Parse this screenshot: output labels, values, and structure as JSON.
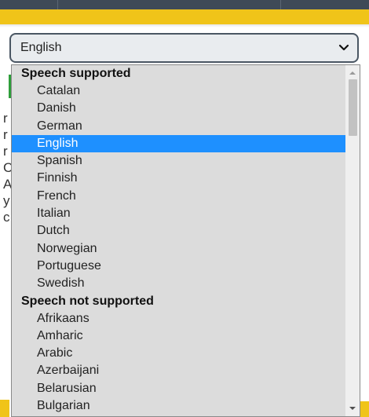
{
  "select": {
    "value": "English"
  },
  "dropdown": {
    "groups": [
      {
        "label": "Speech supported",
        "options": [
          "Catalan",
          "Danish",
          "German",
          "English",
          "Spanish",
          "Finnish",
          "French",
          "Italian",
          "Dutch",
          "Norwegian",
          "Portuguese",
          "Swedish"
        ]
      },
      {
        "label": "Speech not supported",
        "options": [
          "Afrikaans",
          "Amharic",
          "Arabic",
          "Azerbaijani",
          "Belarusian",
          "Bulgarian"
        ]
      }
    ],
    "selected_option": "English"
  },
  "background_letters": [
    "r",
    "r",
    "r",
    "C",
    "A",
    "y",
    "c"
  ],
  "colors": {
    "accent_yellow": "#f0c419",
    "selected_blue": "#1e90ff",
    "dropdown_bg": "#dcdcdc",
    "header_dark": "#3f4a57"
  },
  "icons": {
    "select_chevron": "chevron-down-icon",
    "scroll_up": "scroll-up-arrow-icon",
    "scroll_down": "scroll-down-arrow-icon"
  }
}
